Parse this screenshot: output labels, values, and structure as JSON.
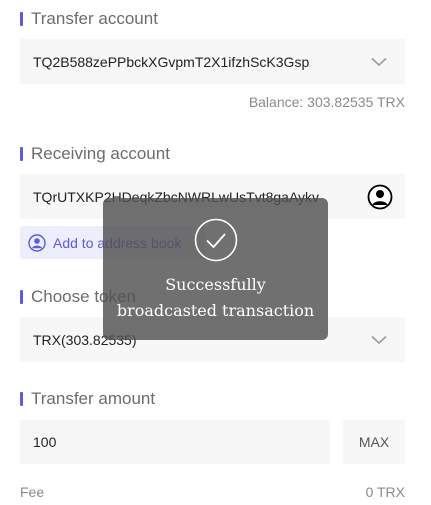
{
  "transfer_account": {
    "title": "Transfer account",
    "address": "TQ2B588zePPbckXGvpmT2X1ifzhScK3Gsp",
    "balance": "Balance: 303.82535 TRX"
  },
  "receiving_account": {
    "title": "Receiving account",
    "address": "TQrUTXKP2HDeqkZbcNWRLwUsTvt8gaAykv",
    "add_to_address_book": "Add to address book"
  },
  "choose_token": {
    "title": "Choose token",
    "selected": "TRX(303.82535)"
  },
  "transfer_amount": {
    "title": "Transfer amount",
    "value": "100",
    "max_label": "MAX"
  },
  "fee": {
    "label": "Fee",
    "value": "0 TRX"
  },
  "toast": {
    "message": "Successfully broadcasted transaction",
    "icon": "check-circle-icon"
  },
  "colors": {
    "accent": "#5b5cd6",
    "field_bg": "#f7f7f8",
    "muted_text": "#8a8a8a"
  }
}
